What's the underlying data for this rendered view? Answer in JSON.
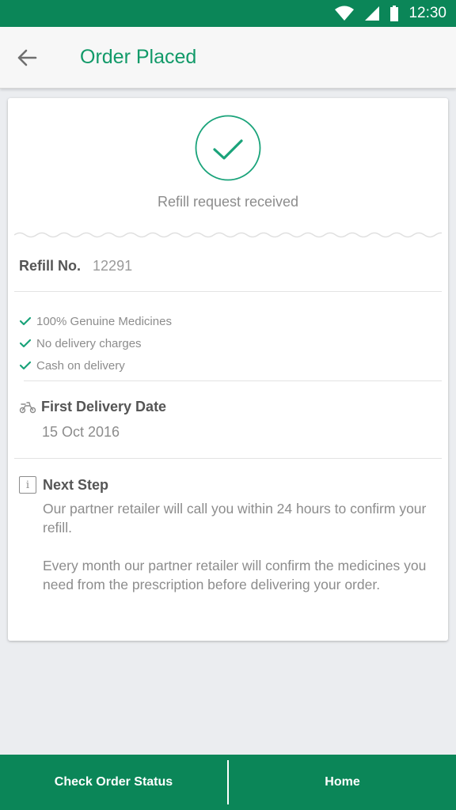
{
  "status_bar": {
    "time": "12:30",
    "icons": [
      "wifi-icon",
      "cell-signal-icon",
      "battery-icon"
    ]
  },
  "header": {
    "back_icon": "arrow-back-icon",
    "title": "Order Placed",
    "title_color": "#129a69"
  },
  "confirmation": {
    "icon": "check-circle-icon",
    "message": "Refill request received"
  },
  "refill": {
    "label": "Refill No.",
    "number": "12291"
  },
  "features": [
    {
      "icon": "check-icon",
      "label": "100% Genuine Medicines"
    },
    {
      "icon": "check-icon",
      "label": "No delivery charges"
    },
    {
      "icon": "check-icon",
      "label": "Cash on delivery"
    }
  ],
  "delivery": {
    "icon": "scooter-icon",
    "title": "First Delivery Date",
    "date": "15 Oct 2016"
  },
  "next_step": {
    "icon": "info-icon",
    "icon_glyph": "i",
    "title": "Next Step",
    "paragraph1": "Our partner retailer will call you within 24 hours to confirm your refill.",
    "paragraph2": "Every month our partner retailer will confirm the medicines you need from the prescription before delivering your order."
  },
  "bottom_bar": {
    "check_status_label": "Check Order Status",
    "home_label": "Home"
  },
  "colors": {
    "brand_green": "#0b8658",
    "accent_teal": "#1aa37a",
    "background": "#ebedf0"
  }
}
